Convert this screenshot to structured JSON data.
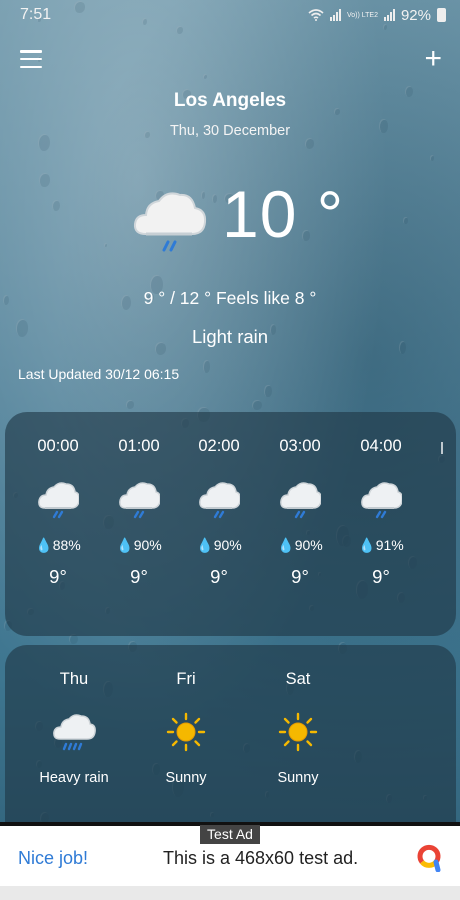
{
  "status_bar": {
    "time": "7:51",
    "battery": "92%",
    "network_label": "Vo)) LTE2"
  },
  "header": {
    "menu_icon": "hamburger-menu-icon",
    "add_icon": "plus-icon",
    "add_label": "+"
  },
  "current": {
    "city": "Los Angeles",
    "date": "Thu, 30 December",
    "icon": "rain-cloud-icon",
    "temperature": "10 °",
    "minmax_feels": "9 ° / 12 ° Feels like 8 °",
    "condition": "Light rain",
    "last_updated": "Last Updated 30/12 06:15"
  },
  "hourly": [
    {
      "time": "00:00",
      "icon": "rain-cloud-icon",
      "humidity": "88%",
      "temp": "9°"
    },
    {
      "time": "01:00",
      "icon": "rain-cloud-icon",
      "humidity": "90%",
      "temp": "9°"
    },
    {
      "time": "02:00",
      "icon": "rain-cloud-icon",
      "humidity": "90%",
      "temp": "9°"
    },
    {
      "time": "03:00",
      "icon": "rain-cloud-icon",
      "humidity": "90%",
      "temp": "9°"
    },
    {
      "time": "04:00",
      "icon": "rain-cloud-icon",
      "humidity": "91%",
      "temp": "9°"
    }
  ],
  "daily": [
    {
      "day": "Thu",
      "icon": "heavy-rain-cloud-icon",
      "condition": "Heavy rain"
    },
    {
      "day": "Fri",
      "icon": "sun-icon",
      "condition": "Sunny"
    },
    {
      "day": "Sat",
      "icon": "sun-icon",
      "condition": "Sunny"
    }
  ],
  "ad": {
    "label": "Test Ad",
    "nice": "Nice job!",
    "text": "This is a 468x60 test ad."
  },
  "colors": {
    "rain_streak": "#2f7bd6",
    "sun": "#f5b800",
    "card_bg": "rgba(30,55,70,0.62)",
    "ad_link": "#2f7bd6"
  }
}
